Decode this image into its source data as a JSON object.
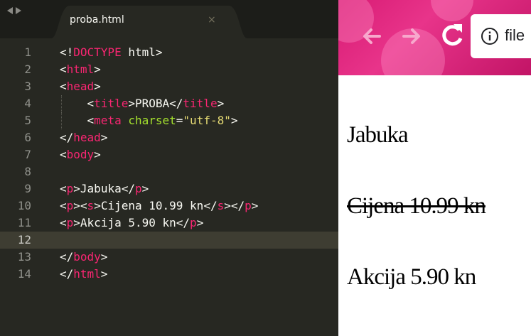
{
  "editor": {
    "tab_name": "proba.html",
    "tab_close": "×",
    "current_line": 12,
    "lines": [
      {
        "num": "1",
        "parts": [
          [
            "p",
            "<!"
          ],
          [
            "t",
            "DOCTYPE"
          ],
          [
            "p",
            " html>"
          ]
        ]
      },
      {
        "num": "2",
        "parts": [
          [
            "p",
            "<"
          ],
          [
            "t",
            "html"
          ],
          [
            "p",
            ">"
          ]
        ]
      },
      {
        "num": "3",
        "parts": [
          [
            "p",
            "<"
          ],
          [
            "t",
            "head"
          ],
          [
            "p",
            ">"
          ]
        ]
      },
      {
        "num": "4",
        "indent": true,
        "parts": [
          [
            "p",
            "    <"
          ],
          [
            "t",
            "title"
          ],
          [
            "p",
            ">PROBA</"
          ],
          [
            "t",
            "title"
          ],
          [
            "p",
            ">"
          ]
        ]
      },
      {
        "num": "5",
        "indent": true,
        "parts": [
          [
            "p",
            "    <"
          ],
          [
            "t",
            "meta"
          ],
          [
            "p",
            " "
          ],
          [
            "a",
            "charset"
          ],
          [
            "p",
            "="
          ],
          [
            "s",
            "\"utf-8\""
          ],
          [
            "p",
            ">"
          ]
        ]
      },
      {
        "num": "6",
        "parts": [
          [
            "p",
            "</"
          ],
          [
            "t",
            "head"
          ],
          [
            "p",
            ">"
          ]
        ]
      },
      {
        "num": "7",
        "parts": [
          [
            "p",
            "<"
          ],
          [
            "t",
            "body"
          ],
          [
            "p",
            ">"
          ]
        ]
      },
      {
        "num": "8",
        "parts": []
      },
      {
        "num": "9",
        "parts": [
          [
            "p",
            "<"
          ],
          [
            "t",
            "p"
          ],
          [
            "p",
            ">Jabuka</"
          ],
          [
            "t",
            "p"
          ],
          [
            "p",
            ">"
          ]
        ]
      },
      {
        "num": "10",
        "parts": [
          [
            "p",
            "<"
          ],
          [
            "t",
            "p"
          ],
          [
            "p",
            "><"
          ],
          [
            "t",
            "s"
          ],
          [
            "p",
            ">Cijena 10.99 kn</"
          ],
          [
            "t",
            "s"
          ],
          [
            "p",
            "></"
          ],
          [
            "t",
            "p"
          ],
          [
            "p",
            ">"
          ]
        ]
      },
      {
        "num": "11",
        "parts": [
          [
            "p",
            "<"
          ],
          [
            "t",
            "p"
          ],
          [
            "p",
            ">Akcija 5.90 kn</"
          ],
          [
            "t",
            "p"
          ],
          [
            "p",
            ">"
          ]
        ]
      },
      {
        "num": "12",
        "parts": []
      },
      {
        "num": "13",
        "parts": [
          [
            "p",
            "</"
          ],
          [
            "t",
            "body"
          ],
          [
            "p",
            ">"
          ]
        ]
      },
      {
        "num": "14",
        "parts": [
          [
            "p",
            "</"
          ],
          [
            "t",
            "html"
          ],
          [
            "p",
            ">"
          ]
        ]
      }
    ]
  },
  "browser": {
    "url_text": "file",
    "paragraphs": {
      "p1": "Jabuka",
      "p2": "Cijena 10.99 kn",
      "p3": "Akcija 5.90 kn"
    }
  },
  "colors": {
    "editor_bg": "#272822",
    "tag": "#f92672",
    "attribute": "#a6e22e",
    "string": "#e6db74",
    "text": "#f8f8f2",
    "browser_toolbar": "#d81b74"
  }
}
